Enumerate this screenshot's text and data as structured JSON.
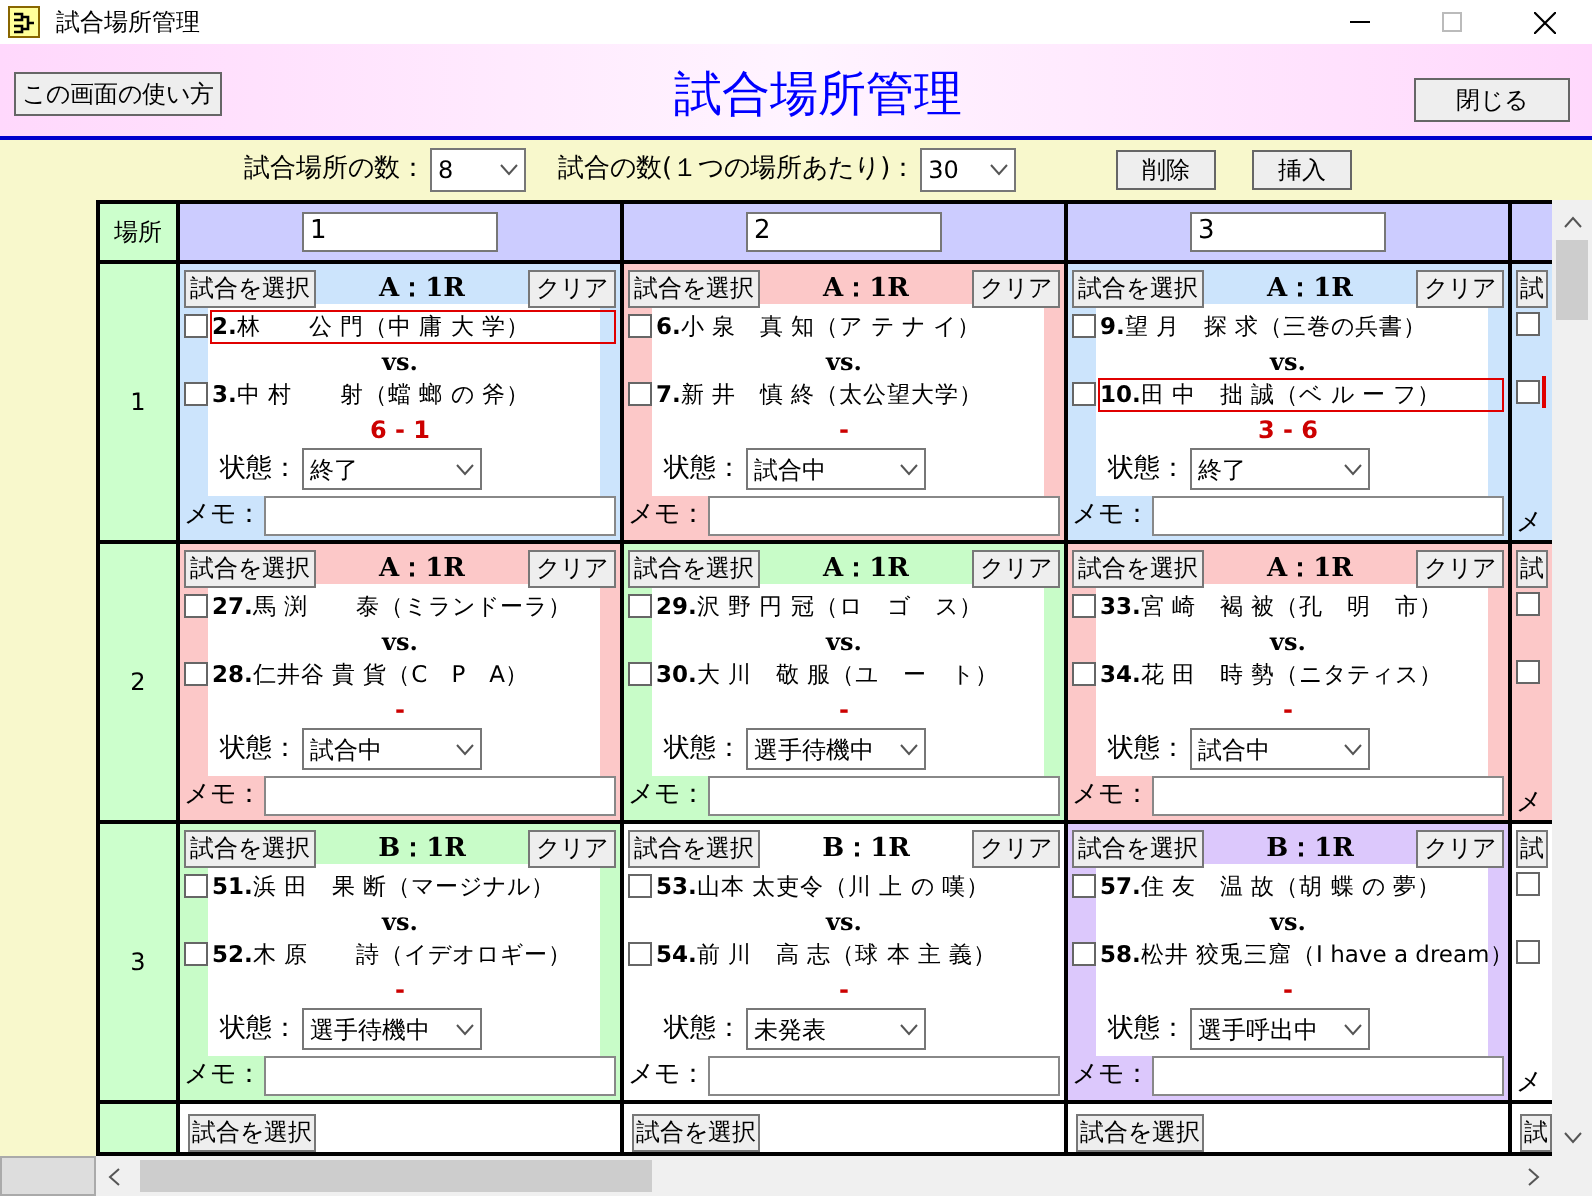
{
  "window": {
    "title": "試合場所管理"
  },
  "header": {
    "help_button": "この画面の使い方",
    "title": "試合場所管理",
    "close_button": "閉じる"
  },
  "controls": {
    "venue_count_label": "試合場所の数：",
    "venue_count": "8",
    "match_count_label": "試合の数(１つの場所あたり)：",
    "match_count": "30",
    "delete_button": "削除",
    "insert_button": "挿入"
  },
  "grid": {
    "corner_label": "場所",
    "columns": [
      {
        "name": "1"
      },
      {
        "name": "2"
      },
      {
        "name": "3"
      },
      {}
    ],
    "rows": [
      {
        "label": "1",
        "cards": [
          {
            "kind": "full",
            "color": "#cce4fc",
            "select_button": "試合を選択",
            "round": "A：1R",
            "clear_button": "クリア",
            "players": [
              {
                "number": "2.",
                "name": "林　　公 門（中 庸 大 学）",
                "checked": false,
                "winner": true
              },
              {
                "number": "3.",
                "name": "中 村　　射（蟷 螂 の 斧）",
                "checked": false,
                "winner": false
              }
            ],
            "vs": "vs.",
            "score": "6 - 1",
            "status_label": "状態：",
            "status": "終了",
            "memo_label": "メモ："
          },
          {
            "kind": "full",
            "color": "#fcc8c8",
            "select_button": "試合を選択",
            "round": "A：1R",
            "clear_button": "クリア",
            "players": [
              {
                "number": "6.",
                "name": "小 泉　真 知（ア テ ナ イ）",
                "checked": false,
                "winner": false
              },
              {
                "number": "7.",
                "name": "新 井　慎 終（太公望大学）",
                "checked": false,
                "winner": false
              }
            ],
            "vs": "vs.",
            "score": "-",
            "status_label": "状態：",
            "status": "試合中",
            "memo_label": "メモ："
          },
          {
            "kind": "full",
            "color": "#cce4fc",
            "select_button": "試合を選択",
            "round": "A：1R",
            "clear_button": "クリア",
            "players": [
              {
                "number": "9.",
                "name": "望 月　探 求（三巻の兵書）",
                "checked": false,
                "winner": false
              },
              {
                "number": "10.",
                "name": "田 中　拙 誠（ベ ル ー フ）",
                "checked": false,
                "winner": true
              }
            ],
            "vs": "vs.",
            "score": "3 - 6",
            "status_label": "状態：",
            "status": "終了",
            "memo_label": "メモ："
          },
          {
            "kind": "partial",
            "color": "#cce4fc",
            "select_button": "試",
            "memo_label": "メ",
            "players": [
              {
                "checked": false,
                "winner": false
              },
              {
                "checked": false,
                "winner": true
              }
            ]
          }
        ]
      },
      {
        "label": "2",
        "cards": [
          {
            "kind": "full",
            "color": "#fcc8c8",
            "select_button": "試合を選択",
            "round": "A：1R",
            "clear_button": "クリア",
            "players": [
              {
                "number": "27.",
                "name": "馬 渕　　泰（ミランドーラ）",
                "checked": false,
                "winner": false
              },
              {
                "number": "28.",
                "name": "仁井谷 貴 貨（C　P　A）",
                "checked": false,
                "winner": false
              }
            ],
            "vs": "vs.",
            "score": "-",
            "status_label": "状態：",
            "status": "試合中",
            "memo_label": "メモ："
          },
          {
            "kind": "full",
            "color": "#c8fcc8",
            "select_button": "試合を選択",
            "round": "A：1R",
            "clear_button": "クリア",
            "players": [
              {
                "number": "29.",
                "name": "沢 野 円 冠（ロ　ゴ　ス）",
                "checked": false,
                "winner": false
              },
              {
                "number": "30.",
                "name": "大 川　敬 服（ユ　ー　ト）",
                "checked": false,
                "winner": false
              }
            ],
            "vs": "vs.",
            "score": "-",
            "status_label": "状態：",
            "status": "選手待機中",
            "memo_label": "メモ："
          },
          {
            "kind": "full",
            "color": "#fcc8c8",
            "select_button": "試合を選択",
            "round": "A：1R",
            "clear_button": "クリア",
            "players": [
              {
                "number": "33.",
                "name": "宮 崎　褐 被（孔　明　市）",
                "checked": false,
                "winner": false
              },
              {
                "number": "34.",
                "name": "花 田　時 勢（ニタティス）",
                "checked": false,
                "winner": false
              }
            ],
            "vs": "vs.",
            "score": "-",
            "status_label": "状態：",
            "status": "試合中",
            "memo_label": "メモ："
          },
          {
            "kind": "partial",
            "color": "#fcc8c8",
            "select_button": "試",
            "memo_label": "メ",
            "players": [
              {
                "checked": false,
                "winner": false
              },
              {
                "checked": false,
                "winner": false
              }
            ]
          }
        ]
      },
      {
        "label": "3",
        "cards": [
          {
            "kind": "full",
            "color": "#c8fcc8",
            "select_button": "試合を選択",
            "round": "B：1R",
            "clear_button": "クリア",
            "players": [
              {
                "number": "51.",
                "name": "浜 田　果 断（マージナル）",
                "checked": false,
                "winner": false
              },
              {
                "number": "52.",
                "name": "木 原　　詩（イデオロギー）",
                "checked": false,
                "winner": false
              }
            ],
            "vs": "vs.",
            "score": "-",
            "status_label": "状態：",
            "status": "選手待機中",
            "memo_label": "メモ："
          },
          {
            "kind": "full",
            "color": "#ffffff",
            "select_button": "試合を選択",
            "round": "B：1R",
            "clear_button": "クリア",
            "players": [
              {
                "number": "53.",
                "name": "山本 太吏令（川 上 の 嘆）",
                "checked": false,
                "winner": false
              },
              {
                "number": "54.",
                "name": "前 川　高 志（球 本 主 義）",
                "checked": false,
                "winner": false
              }
            ],
            "vs": "vs.",
            "score": "-",
            "status_label": "状態：",
            "status": "未発表",
            "memo_label": "メモ："
          },
          {
            "kind": "full",
            "color": "#dcc8fc",
            "select_button": "試合を選択",
            "round": "B：1R",
            "clear_button": "クリア",
            "players": [
              {
                "number": "57.",
                "name": "住 友　温 故（胡 蝶 の 夢）",
                "checked": false,
                "winner": false
              },
              {
                "number": "58.",
                "name": "松井 狡兎三窟（I have a dream）",
                "checked": false,
                "winner": false
              }
            ],
            "vs": "vs.",
            "score": "-",
            "status_label": "状態：",
            "status": "選手呼出中",
            "memo_label": "メモ："
          },
          {
            "kind": "partial",
            "color": "#ffffff",
            "select_button": "試",
            "memo_label": "メ",
            "players": [
              {
                "checked": false,
                "winner": false
              },
              {
                "checked": false,
                "winner": false
              }
            ]
          }
        ]
      },
      {
        "cards": [
          {
            "kind": "stub",
            "color": "#ffffff",
            "select_button": "試合を選択"
          },
          {
            "kind": "stub",
            "color": "#ffffff",
            "select_button": "試合を選択"
          },
          {
            "kind": "stub",
            "color": "#ffffff",
            "select_button": "試合を選択"
          },
          {
            "kind": "stub",
            "color": "#ffffff",
            "select_button": "試"
          }
        ]
      }
    ]
  }
}
